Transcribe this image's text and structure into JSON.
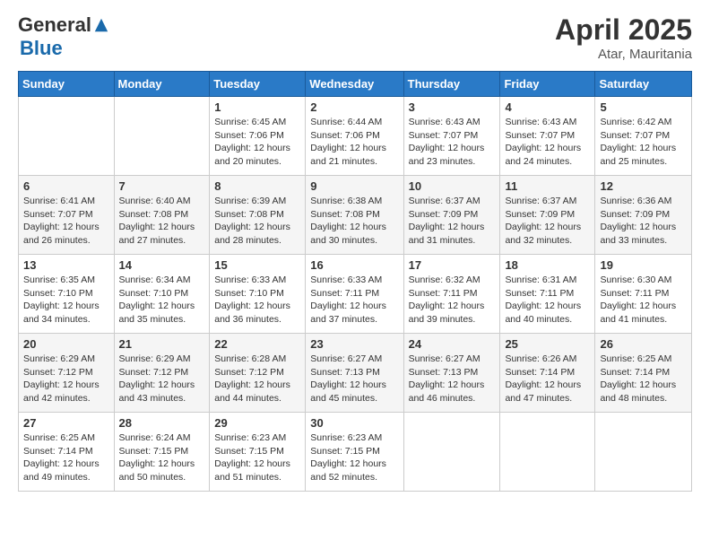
{
  "header": {
    "logo_general": "General",
    "logo_blue": "Blue",
    "month_title": "April 2025",
    "location": "Atar, Mauritania"
  },
  "days_of_week": [
    "Sunday",
    "Monday",
    "Tuesday",
    "Wednesday",
    "Thursday",
    "Friday",
    "Saturday"
  ],
  "weeks": [
    [
      {
        "day": "",
        "sunrise": "",
        "sunset": "",
        "daylight": ""
      },
      {
        "day": "",
        "sunrise": "",
        "sunset": "",
        "daylight": ""
      },
      {
        "day": "1",
        "sunrise": "Sunrise: 6:45 AM",
        "sunset": "Sunset: 7:06 PM",
        "daylight": "Daylight: 12 hours and 20 minutes."
      },
      {
        "day": "2",
        "sunrise": "Sunrise: 6:44 AM",
        "sunset": "Sunset: 7:06 PM",
        "daylight": "Daylight: 12 hours and 21 minutes."
      },
      {
        "day": "3",
        "sunrise": "Sunrise: 6:43 AM",
        "sunset": "Sunset: 7:07 PM",
        "daylight": "Daylight: 12 hours and 23 minutes."
      },
      {
        "day": "4",
        "sunrise": "Sunrise: 6:43 AM",
        "sunset": "Sunset: 7:07 PM",
        "daylight": "Daylight: 12 hours and 24 minutes."
      },
      {
        "day": "5",
        "sunrise": "Sunrise: 6:42 AM",
        "sunset": "Sunset: 7:07 PM",
        "daylight": "Daylight: 12 hours and 25 minutes."
      }
    ],
    [
      {
        "day": "6",
        "sunrise": "Sunrise: 6:41 AM",
        "sunset": "Sunset: 7:07 PM",
        "daylight": "Daylight: 12 hours and 26 minutes."
      },
      {
        "day": "7",
        "sunrise": "Sunrise: 6:40 AM",
        "sunset": "Sunset: 7:08 PM",
        "daylight": "Daylight: 12 hours and 27 minutes."
      },
      {
        "day": "8",
        "sunrise": "Sunrise: 6:39 AM",
        "sunset": "Sunset: 7:08 PM",
        "daylight": "Daylight: 12 hours and 28 minutes."
      },
      {
        "day": "9",
        "sunrise": "Sunrise: 6:38 AM",
        "sunset": "Sunset: 7:08 PM",
        "daylight": "Daylight: 12 hours and 30 minutes."
      },
      {
        "day": "10",
        "sunrise": "Sunrise: 6:37 AM",
        "sunset": "Sunset: 7:09 PM",
        "daylight": "Daylight: 12 hours and 31 minutes."
      },
      {
        "day": "11",
        "sunrise": "Sunrise: 6:37 AM",
        "sunset": "Sunset: 7:09 PM",
        "daylight": "Daylight: 12 hours and 32 minutes."
      },
      {
        "day": "12",
        "sunrise": "Sunrise: 6:36 AM",
        "sunset": "Sunset: 7:09 PM",
        "daylight": "Daylight: 12 hours and 33 minutes."
      }
    ],
    [
      {
        "day": "13",
        "sunrise": "Sunrise: 6:35 AM",
        "sunset": "Sunset: 7:10 PM",
        "daylight": "Daylight: 12 hours and 34 minutes."
      },
      {
        "day": "14",
        "sunrise": "Sunrise: 6:34 AM",
        "sunset": "Sunset: 7:10 PM",
        "daylight": "Daylight: 12 hours and 35 minutes."
      },
      {
        "day": "15",
        "sunrise": "Sunrise: 6:33 AM",
        "sunset": "Sunset: 7:10 PM",
        "daylight": "Daylight: 12 hours and 36 minutes."
      },
      {
        "day": "16",
        "sunrise": "Sunrise: 6:33 AM",
        "sunset": "Sunset: 7:11 PM",
        "daylight": "Daylight: 12 hours and 37 minutes."
      },
      {
        "day": "17",
        "sunrise": "Sunrise: 6:32 AM",
        "sunset": "Sunset: 7:11 PM",
        "daylight": "Daylight: 12 hours and 39 minutes."
      },
      {
        "day": "18",
        "sunrise": "Sunrise: 6:31 AM",
        "sunset": "Sunset: 7:11 PM",
        "daylight": "Daylight: 12 hours and 40 minutes."
      },
      {
        "day": "19",
        "sunrise": "Sunrise: 6:30 AM",
        "sunset": "Sunset: 7:11 PM",
        "daylight": "Daylight: 12 hours and 41 minutes."
      }
    ],
    [
      {
        "day": "20",
        "sunrise": "Sunrise: 6:29 AM",
        "sunset": "Sunset: 7:12 PM",
        "daylight": "Daylight: 12 hours and 42 minutes."
      },
      {
        "day": "21",
        "sunrise": "Sunrise: 6:29 AM",
        "sunset": "Sunset: 7:12 PM",
        "daylight": "Daylight: 12 hours and 43 minutes."
      },
      {
        "day": "22",
        "sunrise": "Sunrise: 6:28 AM",
        "sunset": "Sunset: 7:12 PM",
        "daylight": "Daylight: 12 hours and 44 minutes."
      },
      {
        "day": "23",
        "sunrise": "Sunrise: 6:27 AM",
        "sunset": "Sunset: 7:13 PM",
        "daylight": "Daylight: 12 hours and 45 minutes."
      },
      {
        "day": "24",
        "sunrise": "Sunrise: 6:27 AM",
        "sunset": "Sunset: 7:13 PM",
        "daylight": "Daylight: 12 hours and 46 minutes."
      },
      {
        "day": "25",
        "sunrise": "Sunrise: 6:26 AM",
        "sunset": "Sunset: 7:14 PM",
        "daylight": "Daylight: 12 hours and 47 minutes."
      },
      {
        "day": "26",
        "sunrise": "Sunrise: 6:25 AM",
        "sunset": "Sunset: 7:14 PM",
        "daylight": "Daylight: 12 hours and 48 minutes."
      }
    ],
    [
      {
        "day": "27",
        "sunrise": "Sunrise: 6:25 AM",
        "sunset": "Sunset: 7:14 PM",
        "daylight": "Daylight: 12 hours and 49 minutes."
      },
      {
        "day": "28",
        "sunrise": "Sunrise: 6:24 AM",
        "sunset": "Sunset: 7:15 PM",
        "daylight": "Daylight: 12 hours and 50 minutes."
      },
      {
        "day": "29",
        "sunrise": "Sunrise: 6:23 AM",
        "sunset": "Sunset: 7:15 PM",
        "daylight": "Daylight: 12 hours and 51 minutes."
      },
      {
        "day": "30",
        "sunrise": "Sunrise: 6:23 AM",
        "sunset": "Sunset: 7:15 PM",
        "daylight": "Daylight: 12 hours and 52 minutes."
      },
      {
        "day": "",
        "sunrise": "",
        "sunset": "",
        "daylight": ""
      },
      {
        "day": "",
        "sunrise": "",
        "sunset": "",
        "daylight": ""
      },
      {
        "day": "",
        "sunrise": "",
        "sunset": "",
        "daylight": ""
      }
    ]
  ]
}
